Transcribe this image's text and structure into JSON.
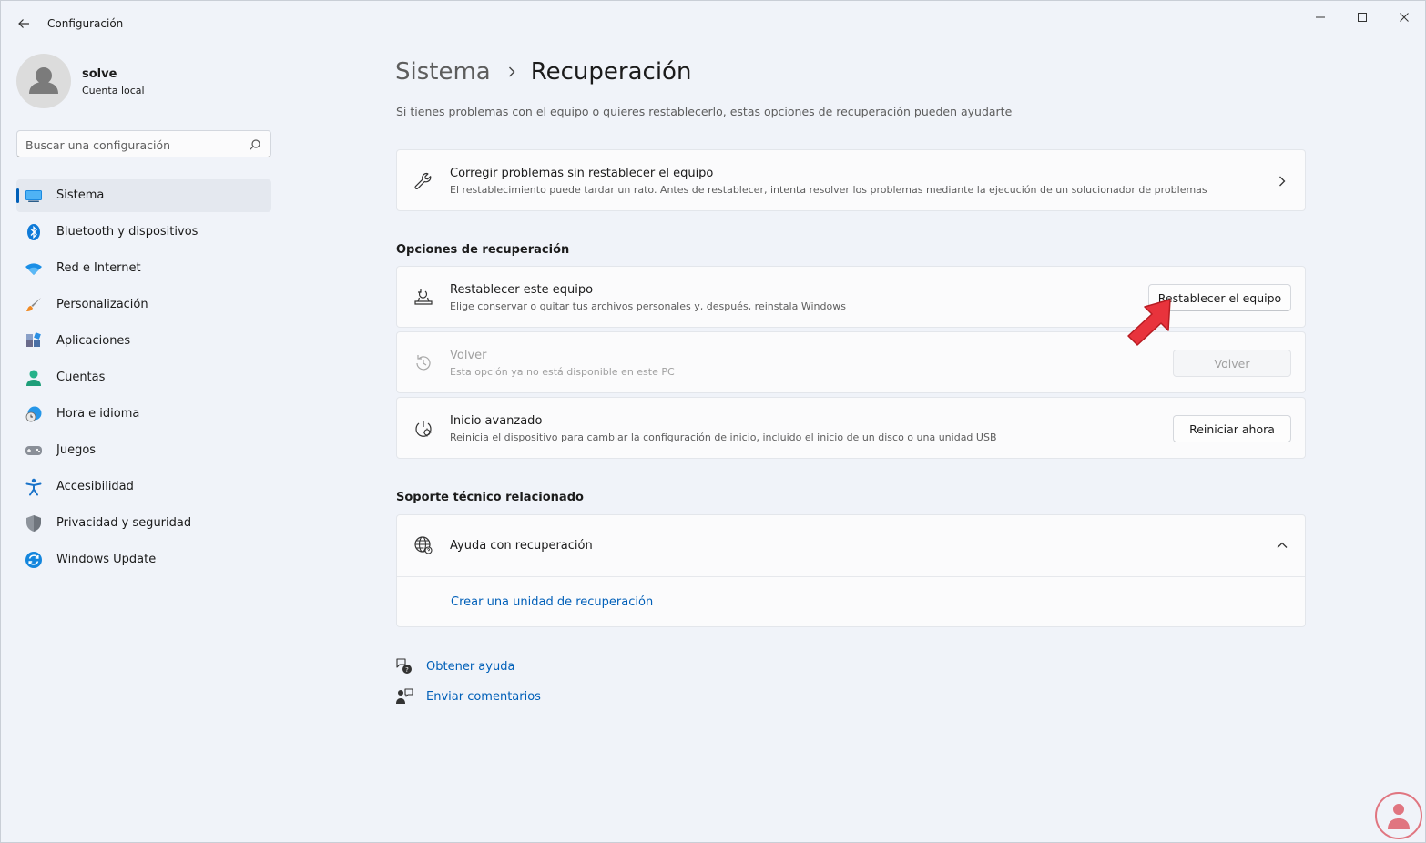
{
  "window": {
    "title": "Configuración"
  },
  "profile": {
    "name": "solve",
    "account_type": "Cuenta local"
  },
  "search": {
    "placeholder": "Buscar una configuración"
  },
  "sidebar": {
    "items": [
      {
        "label": "Sistema",
        "icon": "monitor-icon",
        "active": true
      },
      {
        "label": "Bluetooth y dispositivos",
        "icon": "bluetooth-icon"
      },
      {
        "label": "Red e Internet",
        "icon": "wifi-icon"
      },
      {
        "label": "Personalización",
        "icon": "brush-icon"
      },
      {
        "label": "Aplicaciones",
        "icon": "apps-icon"
      },
      {
        "label": "Cuentas",
        "icon": "person-icon"
      },
      {
        "label": "Hora e idioma",
        "icon": "clock-globe-icon"
      },
      {
        "label": "Juegos",
        "icon": "gamepad-icon"
      },
      {
        "label": "Accesibilidad",
        "icon": "accessibility-icon"
      },
      {
        "label": "Privacidad y seguridad",
        "icon": "shield-icon"
      },
      {
        "label": "Windows Update",
        "icon": "update-icon"
      }
    ]
  },
  "main": {
    "breadcrumb_parent": "Sistema",
    "breadcrumb_current": "Recuperación",
    "description": "Si tienes problemas con el equipo o quieres restablecerlo, estas opciones de recuperación pueden ayudarte",
    "fix_card": {
      "title": "Corregir problemas sin restablecer el equipo",
      "subtitle": "El restablecimiento puede tardar un rato. Antes de restablecer, intenta resolver los problemas mediante la ejecución de un solucionador de problemas"
    },
    "recovery_section_title": "Opciones de recuperación",
    "reset_card": {
      "title": "Restablecer este equipo",
      "subtitle": "Elige conservar o quitar tus archivos personales y, después, reinstala Windows",
      "button": "Restablecer el equipo"
    },
    "goback_card": {
      "title": "Volver",
      "subtitle": "Esta opción ya no está disponible en este PC",
      "button": "Volver"
    },
    "advanced_card": {
      "title": "Inicio avanzado",
      "subtitle": "Reinicia el dispositivo para cambiar la configuración de inicio, incluido el inicio de un disco o una unidad USB",
      "button": "Reiniciar ahora"
    },
    "support_section_title": "Soporte técnico relacionado",
    "help_card": {
      "title": "Ayuda con recuperación",
      "link": "Crear una unidad de recuperación"
    },
    "get_help": "Obtener ayuda",
    "feedback": "Enviar comentarios"
  },
  "colors": {
    "accent": "#005fb8",
    "annotation_arrow": "#e8333c"
  }
}
